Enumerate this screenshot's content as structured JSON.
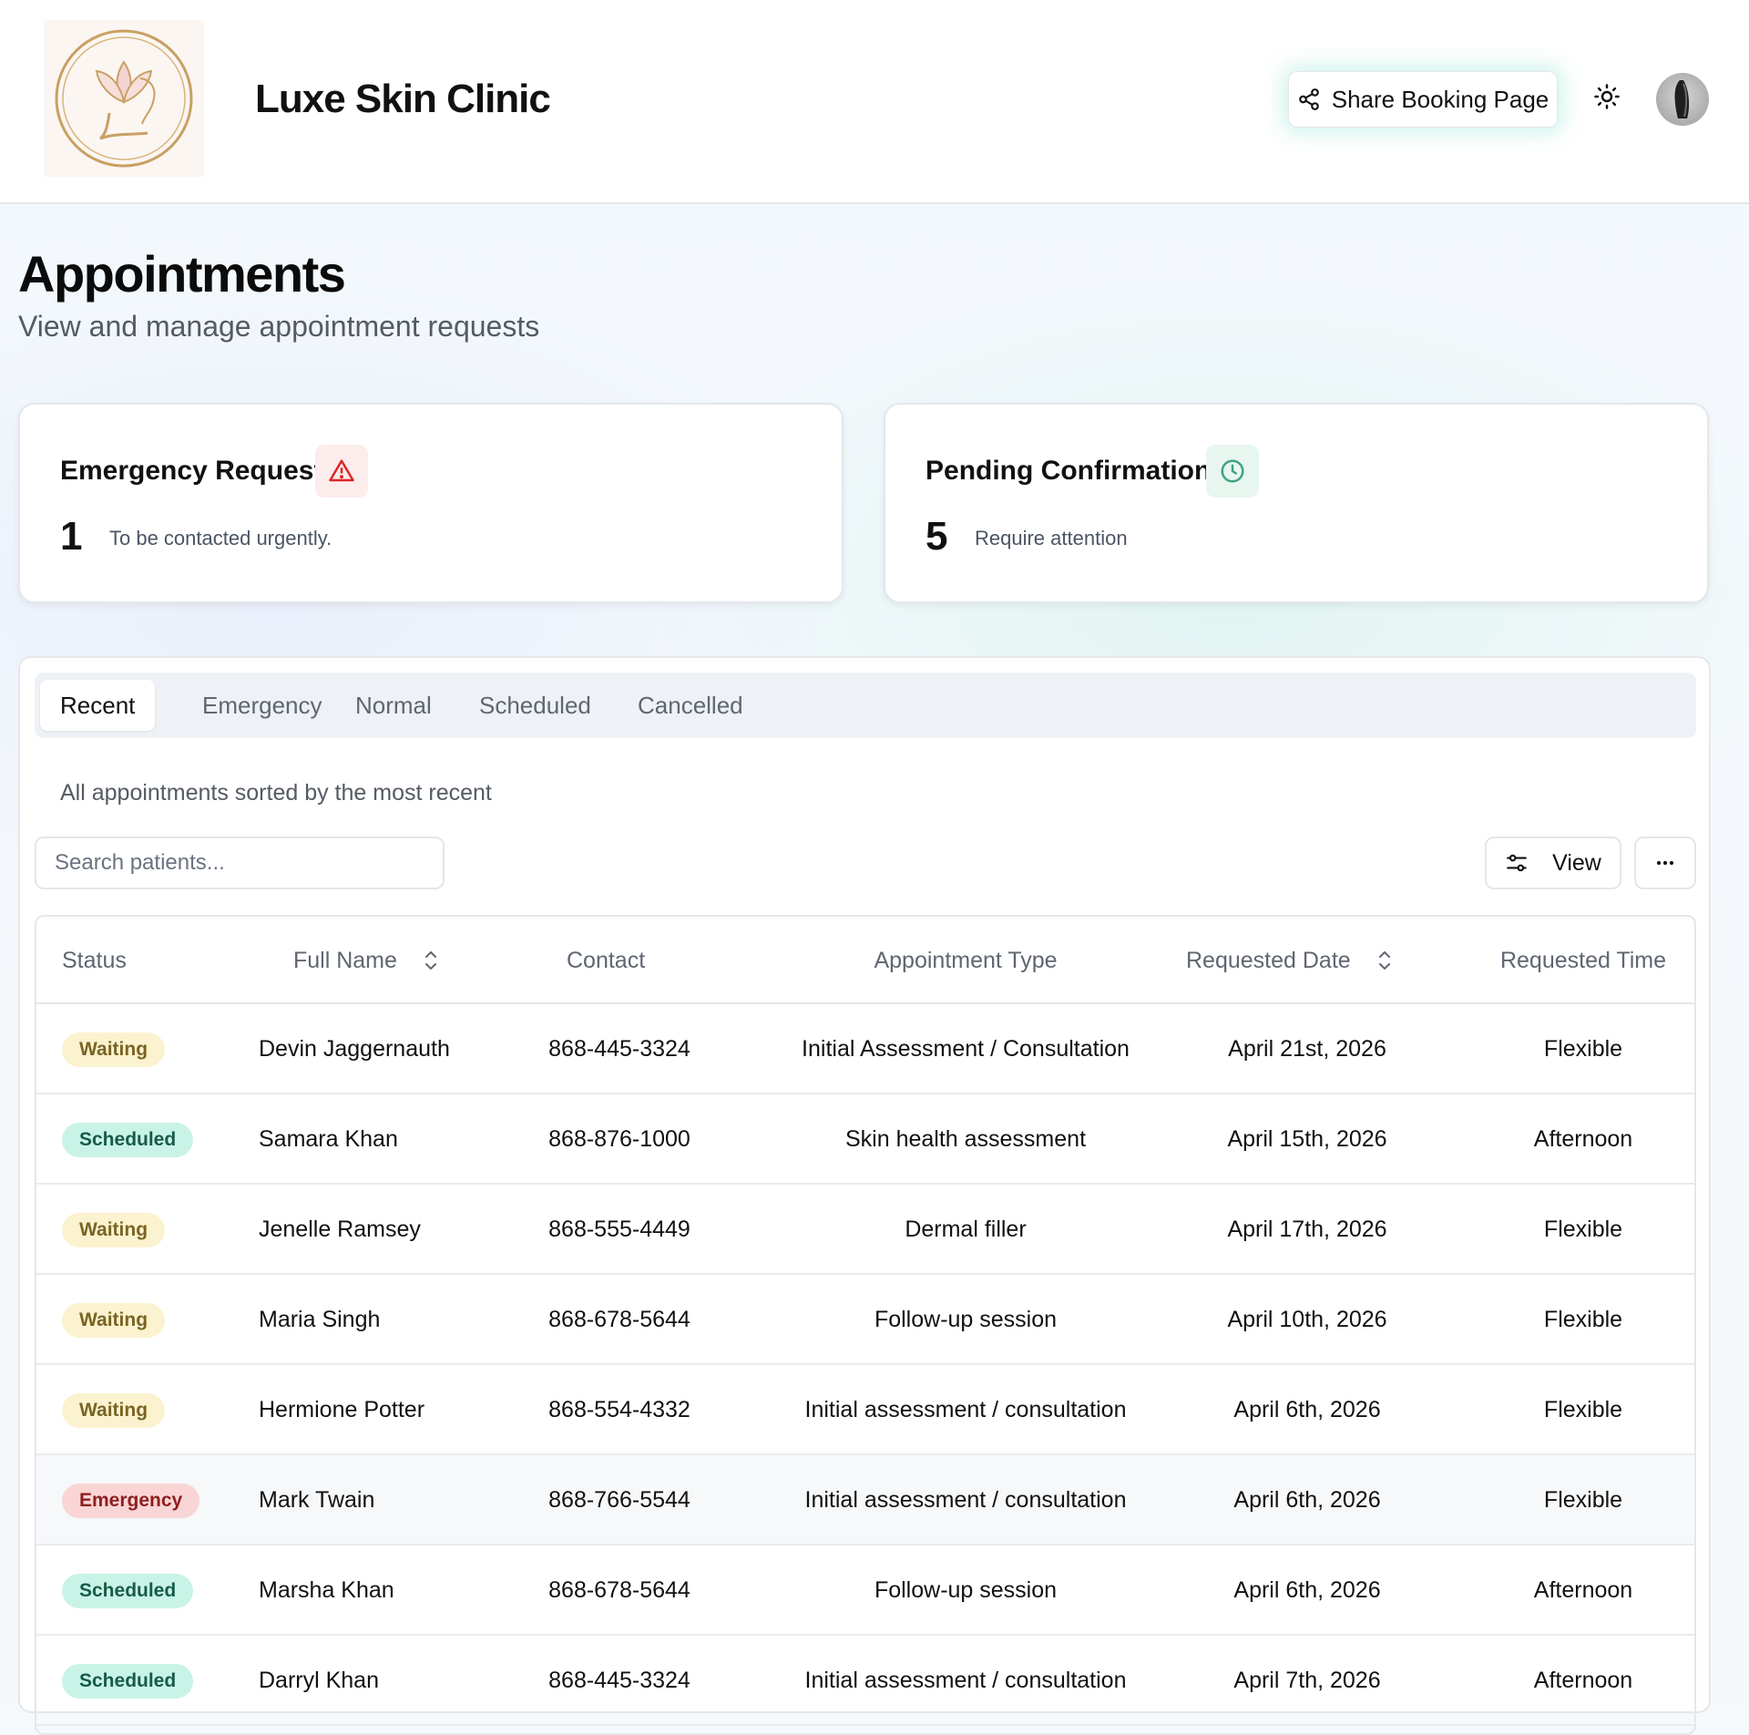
{
  "header": {
    "brand": "Luxe Skin Clinic",
    "share_label": "Share Booking Page"
  },
  "page": {
    "title": "Appointments",
    "subtitle": "View and manage appointment requests"
  },
  "stats": [
    {
      "title": "Emergency Requests",
      "number": "1",
      "note": "To be contacted urgently.",
      "icon": "alert-triangle-icon",
      "accent": "#dc2626"
    },
    {
      "title": "Pending Confirmations",
      "number": "5",
      "note": "Require attention",
      "icon": "clock-icon",
      "accent": "#3fa37f"
    }
  ],
  "tabs": [
    "Recent",
    "Emergency",
    "Normal",
    "Scheduled",
    "Cancelled"
  ],
  "active_tab": "Recent",
  "panel": {
    "description": "All appointments sorted by the most recent",
    "search_placeholder": "Search patients...",
    "view_label": "View"
  },
  "table": {
    "columns": [
      "Status",
      "Full Name",
      "Contact",
      "Appointment Type",
      "Requested Date",
      "Requested Time"
    ],
    "rows": [
      {
        "status": "Waiting",
        "name": "Devin Jaggernauth",
        "contact": "868-445-3324",
        "type": "Initial Assessment / Consultation",
        "date": "April 21st, 2026",
        "time": "Flexible"
      },
      {
        "status": "Scheduled",
        "name": "Samara Khan",
        "contact": "868-876-1000",
        "type": "Skin health assessment",
        "date": "April 15th, 2026",
        "time": "Afternoon"
      },
      {
        "status": "Waiting",
        "name": "Jenelle Ramsey",
        "contact": "868-555-4449",
        "type": "Dermal filler",
        "date": "April 17th, 2026",
        "time": "Flexible"
      },
      {
        "status": "Waiting",
        "name": "Maria Singh",
        "contact": "868-678-5644",
        "type": "Follow-up session",
        "date": "April 10th, 2026",
        "time": "Flexible"
      },
      {
        "status": "Waiting",
        "name": "Hermione Potter",
        "contact": "868-554-4332",
        "type": "Initial assessment / consultation",
        "date": "April 6th, 2026",
        "time": "Flexible"
      },
      {
        "status": "Emergency",
        "name": "Mark Twain",
        "contact": "868-766-5544",
        "type": "Initial assessment / consultation",
        "date": "April 6th, 2026",
        "time": "Flexible"
      },
      {
        "status": "Scheduled",
        "name": "Marsha Khan",
        "contact": "868-678-5644",
        "type": "Follow-up session",
        "date": "April 6th, 2026",
        "time": "Afternoon"
      },
      {
        "status": "Scheduled",
        "name": "Darryl Khan",
        "contact": "868-445-3324",
        "type": "Initial assessment / consultation",
        "date": "April 7th, 2026",
        "time": "Afternoon"
      }
    ]
  }
}
